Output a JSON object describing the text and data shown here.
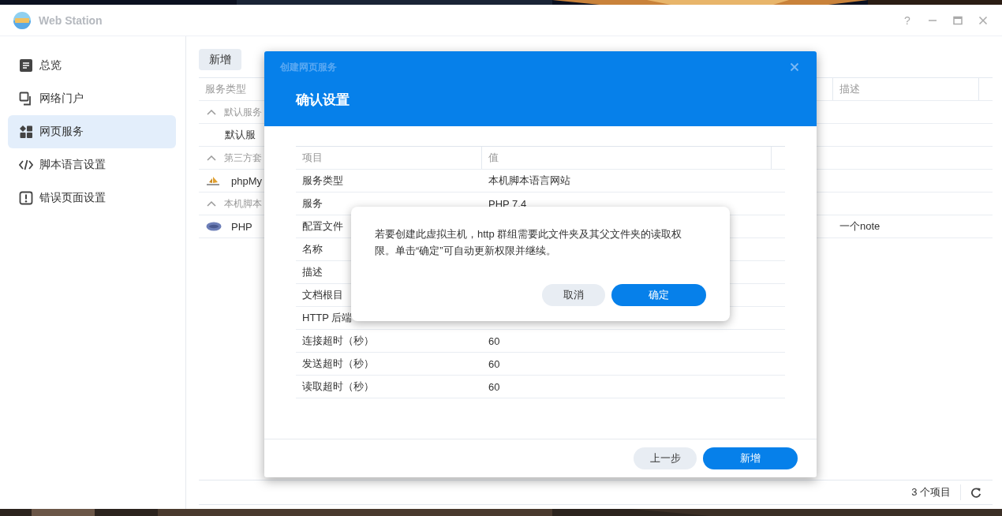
{
  "window": {
    "title": "Web Station",
    "help": "?"
  },
  "sidebar": {
    "items": [
      {
        "label": "总览",
        "selected": false
      },
      {
        "label": "网络门户",
        "selected": false
      },
      {
        "label": "网页服务",
        "selected": true
      },
      {
        "label": "脚本语言设置",
        "selected": false
      },
      {
        "label": "错误页面设置",
        "selected": false
      }
    ]
  },
  "toolbar": {
    "buttons": [
      {
        "label": "新增"
      }
    ]
  },
  "table": {
    "columns": [
      "服务类型",
      "描述"
    ],
    "rows": [
      {
        "kind": "group",
        "label": "默认服务",
        "expanded": true
      },
      {
        "kind": "item",
        "label": "默认服"
      },
      {
        "kind": "group",
        "label": "第三方套",
        "expanded": true
      },
      {
        "kind": "phpmyadmin",
        "label": "phpMy"
      },
      {
        "kind": "group",
        "label": "本机脚本",
        "expanded": true
      },
      {
        "kind": "php",
        "label": "PHP",
        "description": "一个note"
      }
    ]
  },
  "footer": {
    "count": "3 个项目"
  },
  "dialog": {
    "caption": "创建网页服务",
    "title": "确认设置",
    "table": {
      "columns": [
        "项目",
        "值"
      ],
      "rows": [
        {
          "item": "服务类型",
          "value": "本机脚本语言网站"
        },
        {
          "item": "服务",
          "value": "PHP 7.4"
        },
        {
          "item": "配置文件"
        },
        {
          "item": "名称"
        },
        {
          "item": "描述"
        },
        {
          "item": "文档根目"
        },
        {
          "item": "HTTP 后端"
        },
        {
          "item": "连接超时（秒）",
          "value": "60"
        },
        {
          "item": "发送超时（秒）",
          "value": "60"
        },
        {
          "item": "读取超时（秒）",
          "value": "60"
        }
      ]
    },
    "buttons": [
      {
        "label": "上一步",
        "primary": false
      },
      {
        "label": "新增",
        "primary": true
      }
    ]
  },
  "message_box": {
    "text": "若要创建此虚拟主机，http 群组需要此文件夹及其父文件夹的读取权限。单击“确定”可自动更新权限并继续。",
    "buttons": [
      {
        "label": "取消",
        "primary": false
      },
      {
        "label": "确定",
        "primary": true
      }
    ]
  }
}
